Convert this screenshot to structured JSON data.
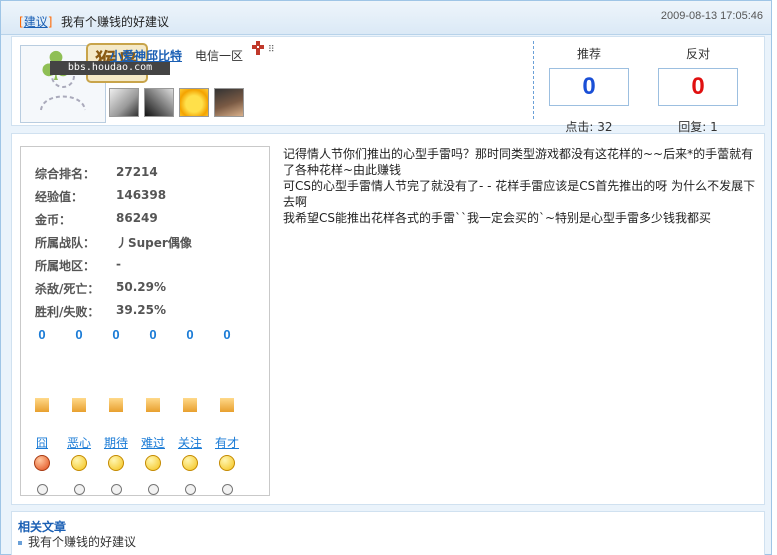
{
  "thread": {
    "category": "建议",
    "title": "我有个赚钱的好建议",
    "date": "2009-08-13 17:05:46"
  },
  "logo": {
    "sign": "猴岛",
    "url_text": "bbs.houdao.com"
  },
  "user": {
    "name": "小爱神邱比特",
    "server": "电信一区"
  },
  "votes": {
    "recommend_label": "推荐",
    "recommend_value": "0",
    "oppose_label": "反对",
    "oppose_value": "0",
    "clicks_label": "点击:",
    "clicks_value": "32",
    "replies_label": "回复:",
    "replies_value": "1"
  },
  "stats": [
    {
      "label": "综合排名：",
      "value": "27214"
    },
    {
      "label": "经验值：",
      "value": "146398"
    },
    {
      "label": "金币：",
      "value": "86249"
    },
    {
      "label": "所属战队：",
      "value": "丿Super偶像"
    },
    {
      "label": "所属地区：",
      "value": "-"
    },
    {
      "label": "杀敌/死亡：",
      "value": "50.29%"
    },
    {
      "label": "胜利/失败：",
      "value": "39.25%"
    }
  ],
  "moods": [
    {
      "label": "囧",
      "count": "0",
      "icon": "angry-face-icon"
    },
    {
      "label": "恶心",
      "count": "0",
      "icon": "sick-face-icon"
    },
    {
      "label": "期待",
      "count": "0",
      "icon": "hopeful-face-icon"
    },
    {
      "label": "难过",
      "count": "0",
      "icon": "sad-face-icon"
    },
    {
      "label": "关注",
      "count": "0",
      "icon": "curious-face-icon"
    },
    {
      "label": "有才",
      "count": "0",
      "icon": "smug-face-icon"
    }
  ],
  "post": {
    "lines": [
      "记得情人节你们推出的心型手雷吗？那时同类型游戏都没有这花样的~~后来*的手蕾就有了各种花样~由此赚钱",
      "可CS的心型手雷情人节完了就没有了- - 花样手雷应该是CS首先推出的呀  为什么不发展下去啊",
      "我希望CS能推出花样各式的手雷``我一定会买的`~特别是心型手雷多少钱我都买"
    ]
  },
  "related": {
    "heading": "相关文章",
    "items": [
      "我有个赚钱的好建议"
    ]
  }
}
